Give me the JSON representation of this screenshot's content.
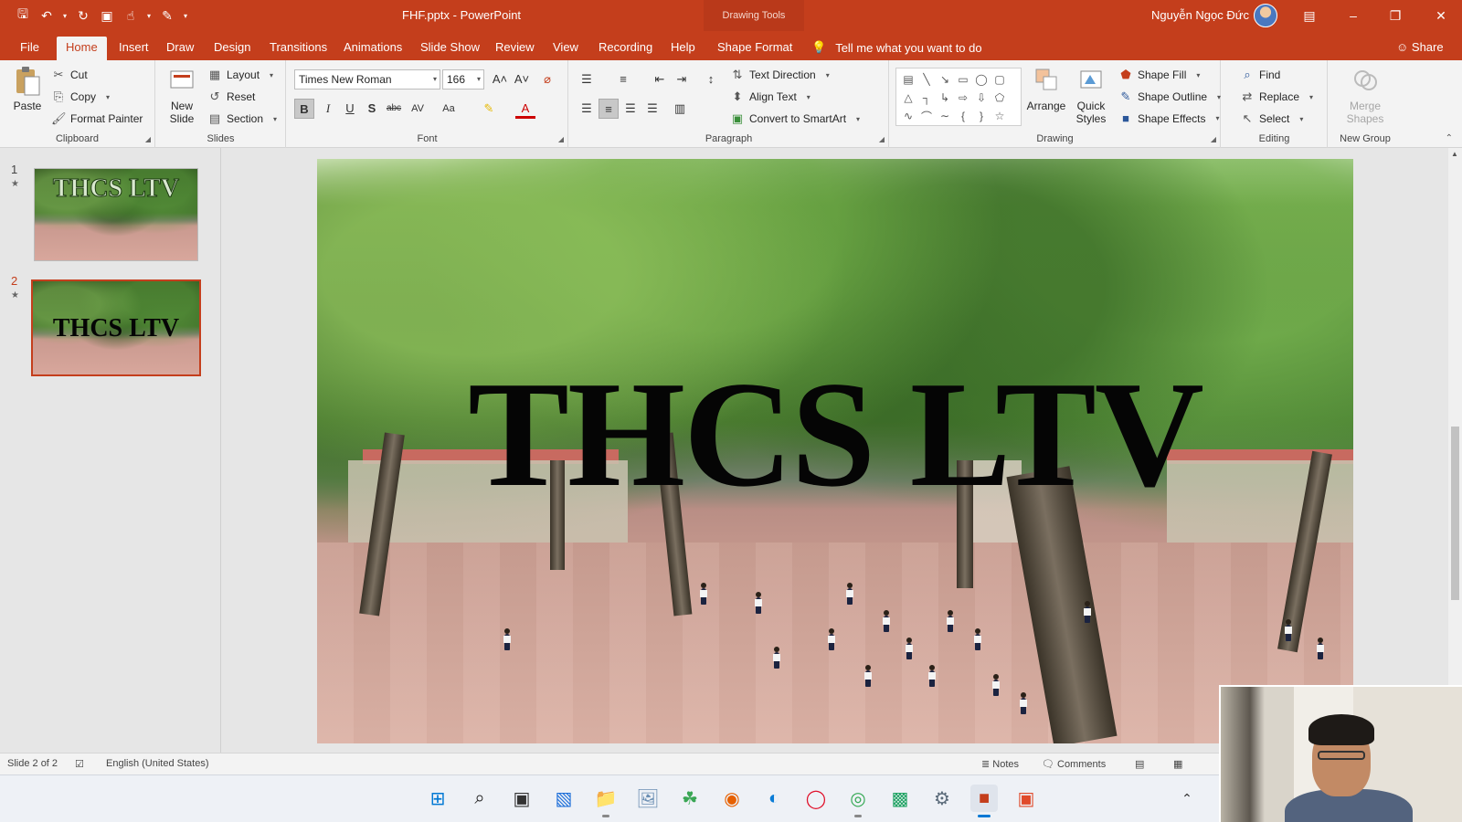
{
  "titlebar": {
    "file_title": "FHF.pptx  -  PowerPoint",
    "contextual": "Drawing Tools",
    "user_name": "Nguyễn Ngọc Đức"
  },
  "tabs": [
    "File",
    "Home",
    "Insert",
    "Draw",
    "Design",
    "Transitions",
    "Animations",
    "Slide Show",
    "Review",
    "View",
    "Recording",
    "Help",
    "Shape Format"
  ],
  "tell_me": "Tell me what you want to do",
  "share": "Share",
  "ribbon": {
    "clipboard": {
      "paste": "Paste",
      "cut": "Cut",
      "copy": "Copy",
      "format_painter": "Format Painter",
      "label": "Clipboard"
    },
    "slides": {
      "new_slide": "New Slide",
      "layout": "Layout",
      "reset": "Reset",
      "section": "Section",
      "label": "Slides"
    },
    "font": {
      "family": "Times New Roman",
      "size": "166",
      "label": "Font"
    },
    "paragraph": {
      "text_direction": "Text Direction",
      "align_text": "Align Text",
      "convert": "Convert to SmartArt",
      "label": "Paragraph"
    },
    "drawing": {
      "arrange": "Arrange",
      "quick_styles": "Quick Styles",
      "shape_fill": "Shape Fill",
      "shape_outline": "Shape Outline",
      "shape_effects": "Shape Effects",
      "label": "Drawing"
    },
    "editing": {
      "find": "Find",
      "replace": "Replace",
      "select": "Select",
      "label": "Editing"
    },
    "newgroup": {
      "merge_shapes": "Merge Shapes",
      "label": "New Group"
    }
  },
  "thumbnails": [
    {
      "number": "1",
      "text": "THCS LTV"
    },
    {
      "number": "2",
      "text": "THCS LTV"
    }
  ],
  "slide": {
    "title": "THCS LTV"
  },
  "status": {
    "slide_of": "Slide 2 of 2",
    "language": "English (United States)",
    "notes": "Notes",
    "comments": "Comments"
  },
  "colors": {
    "accent": "#c43e1c",
    "ribbon_bg": "#f3f3f3"
  }
}
